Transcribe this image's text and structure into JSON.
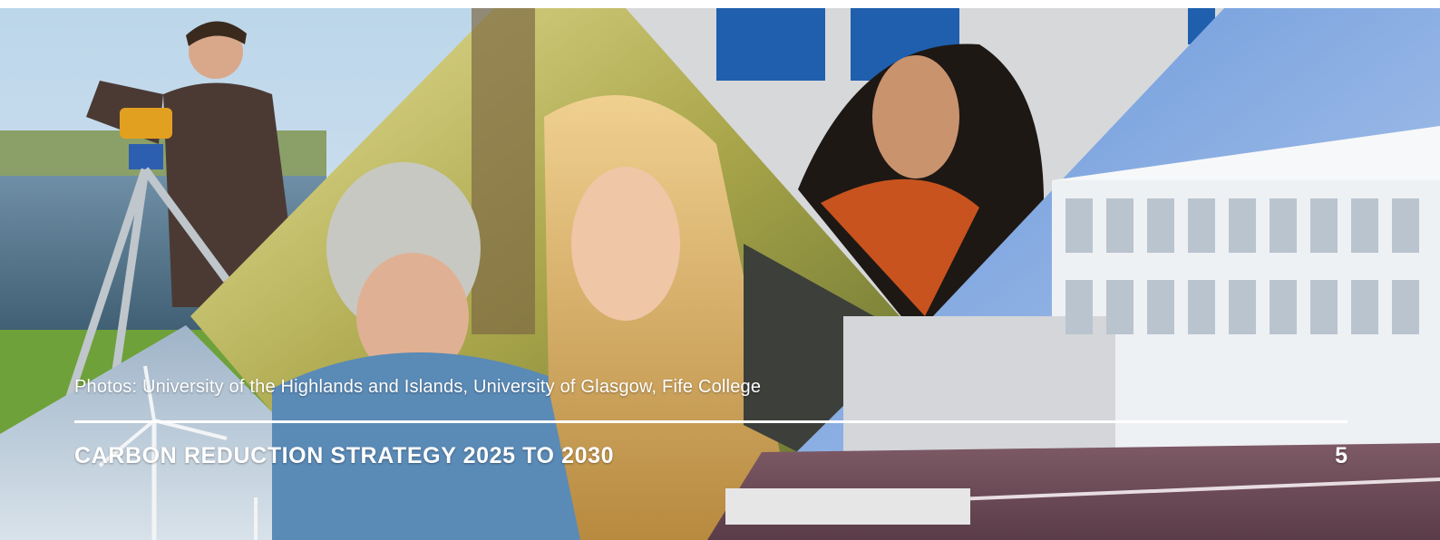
{
  "photo_credit": "Photos: University of the Highlands and Islands, University of Glasgow, Fife College",
  "footer": {
    "title": "CARBON REDUCTION STRATEGY 2025 TO 2030",
    "page_number": "5"
  },
  "colors": {
    "text": "#ffffff",
    "divider": "#ffffff"
  }
}
